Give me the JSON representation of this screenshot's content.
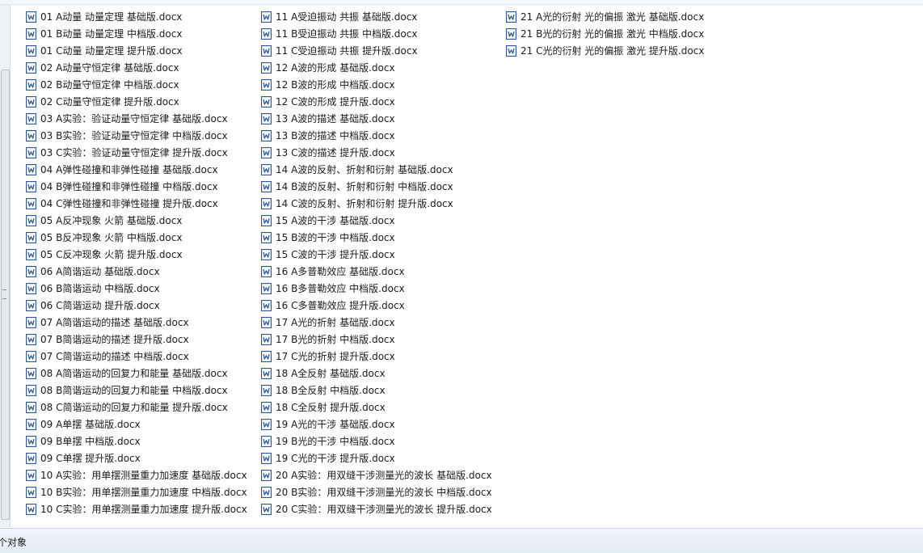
{
  "file_list": {
    "columns": [
      [
        "01 A动量 动量定理 基础版.docx",
        "01 B动量 动量定理 中档版.docx",
        "01 C动量 动量定理 提升版.docx",
        "02 A动量守恒定律 基础版.docx",
        "02 B动量守恒定律 中档版.docx",
        "02 C动量守恒定律 提升版.docx",
        "03 A实验：验证动量守恒定律 基础版.docx",
        "03 B实验：验证动量守恒定律 中档版.docx",
        "03 C实验：验证动量守恒定律 提升版.docx",
        "04 A弹性碰撞和非弹性碰撞 基础版.docx",
        "04 B弹性碰撞和非弹性碰撞 中档版.docx",
        "04 C弹性碰撞和非弹性碰撞 提升版.docx",
        "05 A反冲现象 火箭 基础版.docx",
        "05 B反冲现象 火箭 中档版.docx",
        "05 C反冲现象 火箭 提升版.docx",
        "06 A简谐运动 基础版.docx",
        "06 B简谐运动 中档版.docx",
        "06 C简谐运动 提升版.docx",
        "07 A简谐运动的描述 基础版.docx",
        "07 B简谐运动的描述 提升版.docx",
        "07 C简谐运动的描述 中档版.docx",
        "08 A简谐运动的回复力和能量 基础版.docx",
        "08 B简谐运动的回复力和能量 中档版.docx",
        "08 C简谐运动的回复力和能量 提升版.docx",
        "09 A单摆 基础版.docx",
        "09 B单摆 中档版.docx",
        "09 C单摆 提升版.docx",
        "10 A实验：用单摆测量重力加速度 基础版.docx",
        "10 B实验：用单摆测量重力加速度 中档版.docx",
        "10 C实验：用单摆测量重力加速度 提升版.docx"
      ],
      [
        "11 A受迫振动 共振 基础版.docx",
        "11 B受迫振动 共振 中档版.docx",
        "11 C受迫振动 共振 提升版.docx",
        "12 A波的形成 基础版.docx",
        "12 B波的形成 中档版.docx",
        "12 C波的形成 提升版.docx",
        "13 A波的描述 基础版.docx",
        "13 B波的描述 中档版.docx",
        "13 C波的描述 提升版.docx",
        "14 A波的反射、折射和衍射 基础版.docx",
        "14 B波的反射、折射和衍射 中档版.docx",
        "14 C波的反射、折射和衍射 提升版.docx",
        "15 A波的干涉 基础版.docx",
        "15 B波的干涉 中档版.docx",
        "15 C波的干涉 提升版.docx",
        "16 A多普勒效应 基础版.docx",
        "16 B多普勒效应 中档版.docx",
        "16 C多普勒效应 提升版.docx",
        "17 A光的折射 基础版.docx",
        "17 B光的折射 中档版.docx",
        "17 C光的折射 提升版.docx",
        "18 A全反射 基础版.docx",
        "18 B全反射 中档版.docx",
        "18 C全反射 提升版.docx",
        "19 A光的干涉 基础版.docx",
        "19 B光的干涉 中档版.docx",
        "19 C光的干涉 提升版.docx",
        "20 A实验：用双缝干涉测量光的波长 基础版.docx",
        "20 B实验：用双缝干涉测量光的波长 中档版.docx",
        "20 C实验：用双缝干涉测量光的波长 提升版.docx"
      ],
      [
        "21 A光的衍射  光的偏振 激光 基础版.docx",
        "21 B光的衍射  光的偏振 激光 中档版.docx",
        "21 C光的衍射  光的偏振 激光 提升版.docx"
      ]
    ]
  },
  "status_bar": {
    "text": "个对象"
  },
  "icons": {
    "file_icon": "word-document-icon",
    "word_blue": "#2b5797",
    "word_light": "#dfe8f5"
  }
}
